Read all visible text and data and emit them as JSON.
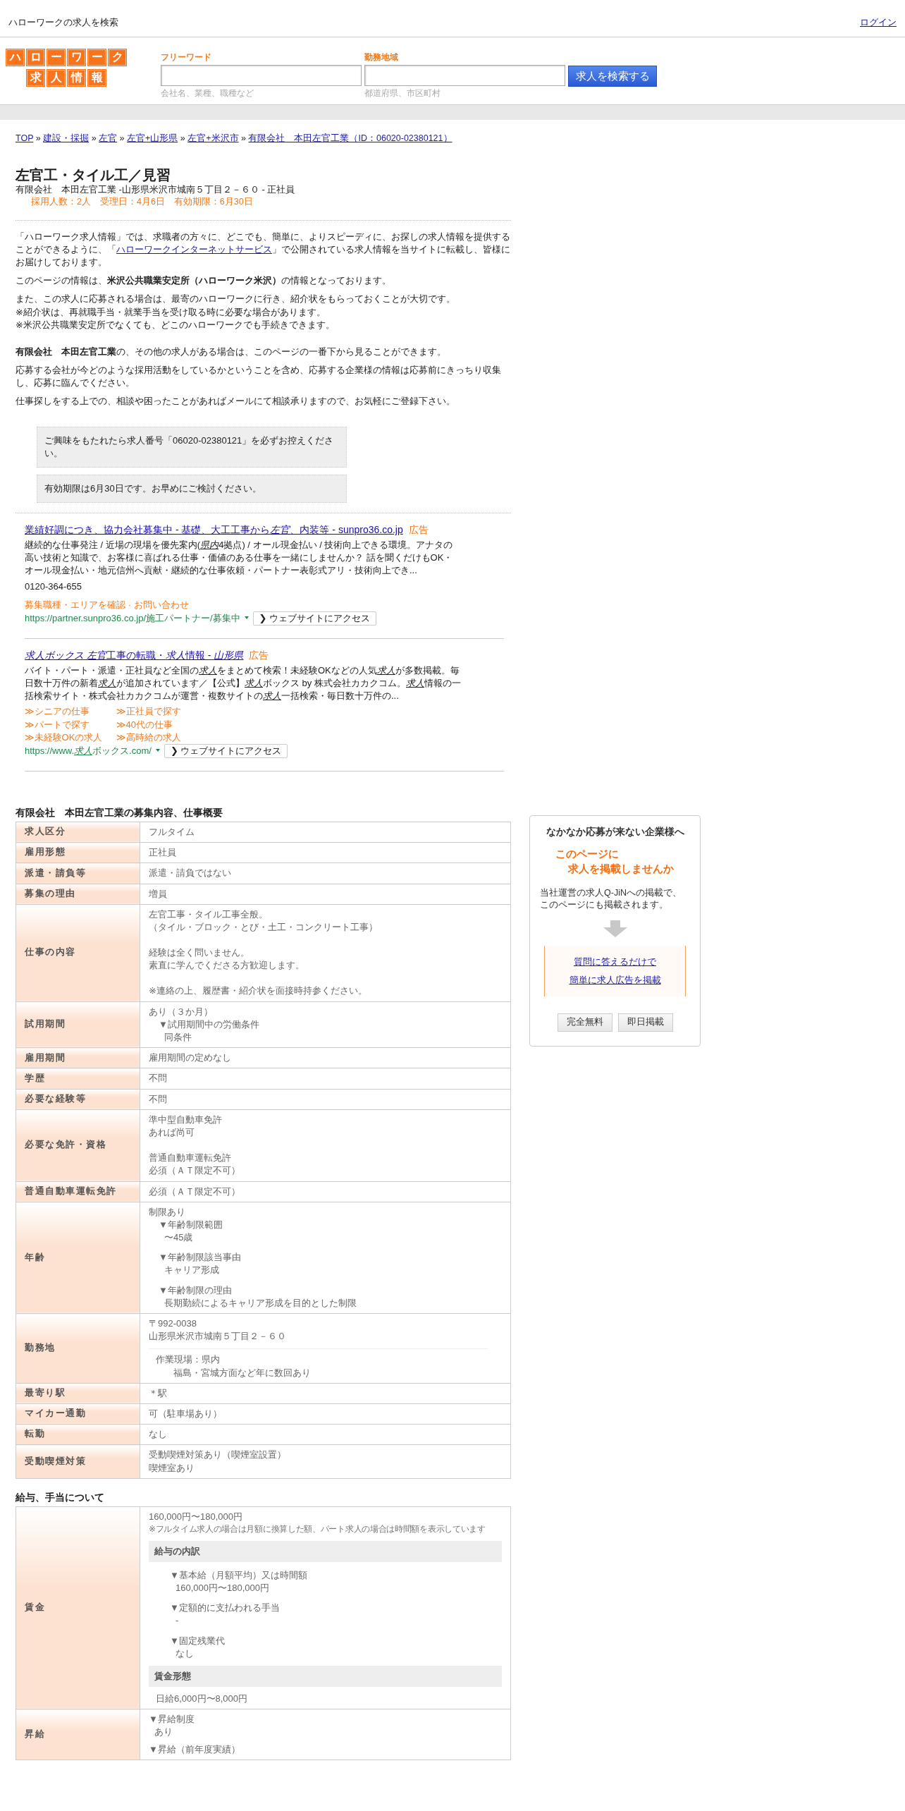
{
  "header": {
    "site_text": "ハローワークの求人を検索",
    "login": "ログイン"
  },
  "logo": {
    "top": [
      "ハ",
      "ロ",
      "ー",
      "ワ",
      "ー",
      "ク"
    ],
    "bottom": [
      "求",
      "人",
      "情",
      "報"
    ]
  },
  "search": {
    "fields": [
      {
        "label": "フリーワード",
        "hint": "会社名、業種、職種など"
      },
      {
        "label": "勤務地域",
        "hint": "都道府県、市区町村"
      }
    ],
    "button": "求人を検索する"
  },
  "breadcrumb": {
    "separator": "»",
    "items": [
      "TOP",
      "建設・採掘",
      "左官",
      "左官+山形県",
      "左官+米沢市",
      "有限会社　本田左官工業（ID：06020-02380121）"
    ]
  },
  "job": {
    "title": "左官工・タイル工／見習",
    "subtitle": "有限会社　本田左官工業 -山形県米沢市城南５丁目２－６０ - 正社員",
    "meta": "採用人数：2人　受理日：4月6日　有効期限：6月30日"
  },
  "intro": {
    "before": "「ハローワーク求人情報」では、求職者の方々に、どこでも、簡単に、よりスピーディに、お探しの求人情報を提供することができるように、「",
    "link": "ハローワークインターネットサービス",
    "after": "」で公開されている求人情報を当サイトに転載し、皆様にお届けしております。"
  },
  "paragraphs": [
    {
      "lines": [
        "このページの情報は、**米沢公共職業安定所（ハローワーク米沢）**の情報となっております。"
      ]
    },
    {
      "lines": [
        "また、この求人に応募される場合は、最寄のハローワークに行き、紹介状をもらっておくことが大切です。",
        "※紹介状は、再就職手当・就業手当を受け取る時に必要な場合があります。",
        "※米沢公共職業安定所でなくても、どこのハローワークでも手続きできます。"
      ]
    }
  ],
  "paragraphs2": [
    "**有限会社　本田左官工業**の、その他の求人がある場合は、このページの一番下から見ることができます。",
    "応募する会社が今どのような採用活動をしているかということを含め、応募する企業様の情報は応募前にきっちり収集し、応募に臨んでください。",
    "仕事探しをする上での、相談や困ったことがあればメールにて相談承りますので、お気軽にご登録下さい。"
  ],
  "notices": [
    "ご興味をもたれたら求人番号「06020-02380121」を必ずお控えください。",
    "有効期限は6月30日です。お早めにご検討ください。"
  ],
  "ads": [
    {
      "title": [
        {
          "text": "業績好調につき、協力会社募集中 - 基礎、大工工事から",
          "em": false
        },
        {
          "text": "左官",
          "em": true
        },
        {
          "text": "、内装等 - sunpro36.co.jp",
          "em": false
        }
      ],
      "label": "広告",
      "description": [
        {
          "text": "継続的な仕事発注 / 近場の現場を優先案内(",
          "em": false
        },
        {
          "text": "県内",
          "em": true
        },
        {
          "text": "4拠点) / オール現金払い / 技術向上できる環境。アナタの高い技術と知識で、お客様に喜ばれる仕事・価値のある仕事を一緒にしませんか？ 話を聞くだけもOK・オール現金払い・地元信州へ貢献・継続的な仕事依頼・パートナー表彰式アリ・技術向上でき...",
          "em": false
        }
      ],
      "phone": "0120-364-655",
      "kind": "inline",
      "separator": "·",
      "sitelinks": [
        "募集職種・エリアを確認",
        "お問い合わせ"
      ],
      "url": [
        {
          "text": "https://partner.sunpro36.co.jp/施工パートナー/募集中",
          "em": false
        }
      ],
      "button": "❯ ウェブサイトにアクセス"
    },
    {
      "title": [
        {
          "text": "求人ボックス 左官",
          "em": true
        },
        {
          "text": "工事の転職・",
          "em": false
        },
        {
          "text": "求人",
          "em": true
        },
        {
          "text": "情報 - ",
          "em": false
        },
        {
          "text": "山形県",
          "em": true
        }
      ],
      "label": "広告",
      "description": [
        {
          "text": "バイト・パート・派遣・正社員など全国の",
          "em": false
        },
        {
          "text": "求人",
          "em": true
        },
        {
          "text": "をまとめて検索！未経験OKなどの人気",
          "em": false
        },
        {
          "text": "求人",
          "em": true
        },
        {
          "text": "が多数掲載。毎日数十万件の新着",
          "em": false
        },
        {
          "text": "求人",
          "em": true
        },
        {
          "text": "が追加されています／【公式】",
          "em": false
        },
        {
          "text": "求人",
          "em": true
        },
        {
          "text": "ボックス by 株式会社カカクコム。",
          "em": false
        },
        {
          "text": "求人",
          "em": true
        },
        {
          "text": "情報の一括検索サイト・株式会社カカクコムが運営・複数サイトの",
          "em": false
        },
        {
          "text": "求人",
          "em": true
        },
        {
          "text": "一括検索・毎日数十万件の...",
          "em": false
        }
      ],
      "kind": "grid",
      "sitelinks": [
        "≫シニアの仕事",
        "≫正社員で探す",
        "≫パートで探す",
        "≫40代の仕事",
        "≫未経験OKの求人",
        "≫高時給の求人"
      ],
      "url": [
        {
          "text": "https://www.",
          "em": false
        },
        {
          "text": "求人",
          "em": true
        },
        {
          "text": "ボックス.com/",
          "em": false
        }
      ],
      "button": "❯ ウェブサイトにアクセス"
    }
  ],
  "sections": [
    {
      "title": "有限会社　本田左官工業の募集内容、仕事概要",
      "rows": [
        {
          "label": "求人区分",
          "blocks": [
            {
              "kind": "para",
              "lines": [
                "フルタイム"
              ]
            }
          ]
        },
        {
          "label": "雇用形態",
          "blocks": [
            {
              "kind": "para",
              "lines": [
                "正社員"
              ]
            }
          ]
        },
        {
          "label": "派遣・請負等",
          "blocks": [
            {
              "kind": "para",
              "lines": [
                "派遣・請負ではない"
              ]
            }
          ]
        },
        {
          "label": "募集の理由",
          "blocks": [
            {
              "kind": "para",
              "lines": [
                "増員"
              ]
            }
          ]
        },
        {
          "label": "仕事の内容",
          "blocks": [
            {
              "kind": "para",
              "lines": [
                "左官工事・タイル工事全般。",
                "（タイル・ブロック・とび・土工・コンクリート工事）"
              ]
            },
            {
              "kind": "para",
              "lines": [
                "経験は全く問いません。",
                "素直に学んでくださる方歓迎します。"
              ]
            },
            {
              "kind": "para",
              "lines": [
                "※連絡の上、履歴書・紹介状を面接時持参ください。"
              ]
            }
          ]
        },
        {
          "label": "試用期間",
          "blocks": [
            {
              "kind": "para",
              "lines": [
                "あり（３か月）"
              ]
            },
            {
              "kind": "item-tight",
              "title": "▼試用期間中の労働条件",
              "value": "同条件"
            }
          ]
        },
        {
          "label": "雇用期間",
          "blocks": [
            {
              "kind": "para",
              "lines": [
                "雇用期間の定めなし"
              ]
            }
          ]
        },
        {
          "label": "学歴",
          "blocks": [
            {
              "kind": "para",
              "lines": [
                "不問"
              ]
            }
          ]
        },
        {
          "label": "必要な経験等",
          "blocks": [
            {
              "kind": "para",
              "lines": [
                "不問"
              ]
            }
          ]
        },
        {
          "label": "必要な免許・資格",
          "blocks": [
            {
              "kind": "para",
              "lines": [
                "準中型自動車免許",
                "あれば尚可"
              ]
            },
            {
              "kind": "para",
              "lines": [
                "普通自動車運転免許",
                "必須（ＡＴ限定不可）"
              ]
            }
          ]
        },
        {
          "label": "普通自動車運転免許",
          "blocks": [
            {
              "kind": "para",
              "lines": [
                "必須（ＡＴ限定不可）"
              ]
            }
          ]
        },
        {
          "label": "年齢",
          "blocks": [
            {
              "kind": "para",
              "lines": [
                "制限あり"
              ]
            },
            {
              "kind": "item-tight",
              "title": "▼年齢制限範囲",
              "value": "〜45歳"
            },
            {
              "kind": "item",
              "title": "▼年齢制限該当事由",
              "value": "キャリア形成"
            },
            {
              "kind": "item",
              "title": "▼年齢制限の理由",
              "value": "長期勤続によるキャリア形成を目的とした制限"
            }
          ]
        },
        {
          "label": "勤務地",
          "blocks": [
            {
              "kind": "para",
              "lines": [
                "〒992-0038",
                "山形県米沢市城南５丁目２－６０"
              ]
            },
            {
              "kind": "rule"
            },
            {
              "kind": "site",
              "title": "作業現場：県内",
              "value": "福島・宮城方面など年に数回あり"
            }
          ]
        },
        {
          "label": "最寄り駅",
          "blocks": [
            {
              "kind": "para",
              "lines": [
                "＊駅"
              ]
            }
          ]
        },
        {
          "label": "マイカー通勤",
          "blocks": [
            {
              "kind": "para",
              "lines": [
                "可（駐車場あり）"
              ]
            }
          ]
        },
        {
          "label": "転勤",
          "blocks": [
            {
              "kind": "para",
              "lines": [
                "なし"
              ]
            }
          ]
        },
        {
          "label": "受動喫煙対策",
          "blocks": [
            {
              "kind": "para",
              "lines": [
                "受動喫煙対策あり（喫煙室設置）",
                "喫煙室あり"
              ]
            }
          ]
        }
      ]
    },
    {
      "title": "給与、手当について",
      "rows": [
        {
          "label": "賃金",
          "blocks": [
            {
              "kind": "para",
              "lines": [
                "160,000円〜180,000円"
              ]
            },
            {
              "kind": "note",
              "text": "※フルタイム求人の場合は月額に換算した額、パート求人の場合は時間額を表示しています"
            },
            {
              "kind": "heading",
              "text": "給与の内訳"
            },
            {
              "kind": "item-deep",
              "title": "▼基本給（月額平均）又は時間額",
              "value": "160,000円〜180,000円"
            },
            {
              "kind": "item-deep",
              "title": "▼定額的に支払われる手当",
              "value": "-"
            },
            {
              "kind": "item-deep",
              "title": "▼固定残業代",
              "value": "なし"
            },
            {
              "kind": "heading",
              "text": "賃金形態"
            },
            {
              "kind": "value",
              "text": "日給6,000円〜8,000円"
            }
          ]
        },
        {
          "label": "昇給",
          "blocks": [
            {
              "kind": "item-flat",
              "title": "▼昇給制度",
              "value": "あり"
            },
            {
              "kind": "item-flat",
              "title": "▼昇給（前年度実績）"
            }
          ]
        }
      ]
    }
  ],
  "sidebar": {
    "title": "なかなか応募が来ない企業様へ",
    "catch": [
      "このページに",
      "求人を掲載しませんか"
    ],
    "text": [
      "当社運営の求人Q-JiNへの掲載で、",
      "このページにも掲載されます。"
    ],
    "links": [
      "質問に答えるだけで",
      "簡単に求人広告を掲載"
    ],
    "buttons": [
      "完全無料",
      "即日掲載"
    ]
  }
}
